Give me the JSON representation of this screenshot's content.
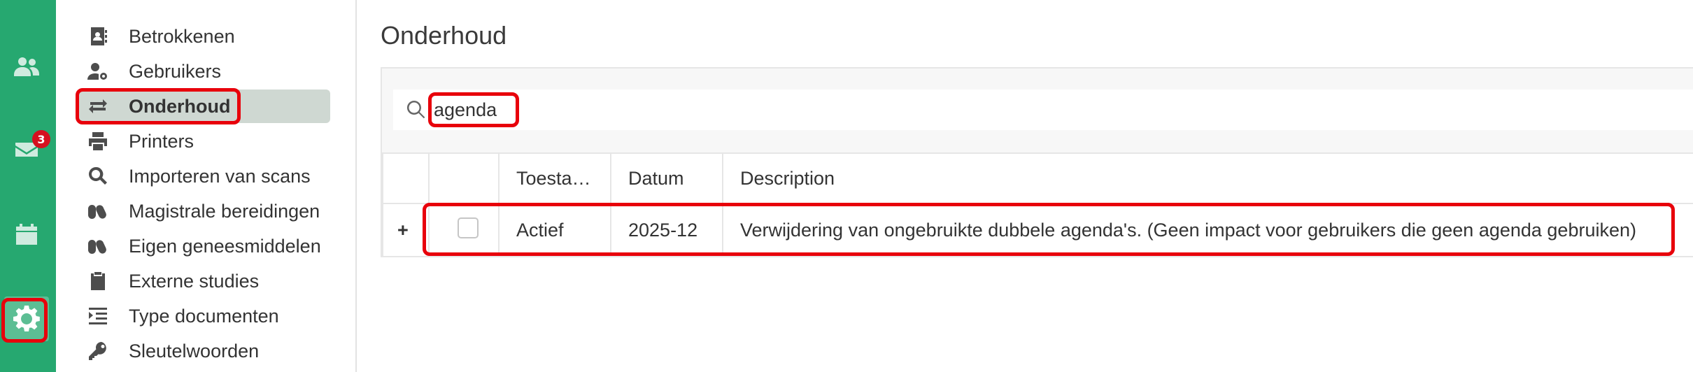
{
  "rail": {
    "items": [
      {
        "name": "users",
        "icon": "users-icon"
      },
      {
        "name": "messages",
        "icon": "envelope-icon",
        "badge": "3"
      },
      {
        "name": "calendar",
        "icon": "calendar-icon"
      },
      {
        "name": "settings",
        "icon": "gear-icon",
        "active": true
      }
    ]
  },
  "nav": {
    "items": [
      {
        "label": "Betrokkenen",
        "icon": "contact-book-icon"
      },
      {
        "label": "Gebruikers",
        "icon": "user-gear-icon"
      },
      {
        "label": "Onderhoud",
        "icon": "swap-arrows-icon",
        "active": true
      },
      {
        "label": "Printers",
        "icon": "printer-icon"
      },
      {
        "label": "Importeren van scans",
        "icon": "search-icon"
      },
      {
        "label": "Magistrale bereidingen",
        "icon": "capsules-icon"
      },
      {
        "label": "Eigen geneesmiddelen",
        "icon": "capsules-icon"
      },
      {
        "label": "Externe studies",
        "icon": "clipboard-icon"
      },
      {
        "label": "Type documenten",
        "icon": "indent-list-icon"
      },
      {
        "label": "Sleutelwoorden",
        "icon": "key-icon"
      }
    ]
  },
  "main": {
    "title": "Onderhoud",
    "search": {
      "value": "agenda",
      "placeholder": ""
    },
    "table": {
      "columns": [
        "",
        "",
        "Toesta…",
        "Datum",
        "Description"
      ],
      "rows": [
        {
          "expand": "+",
          "checked": false,
          "status": "Actief",
          "date": "2025-12",
          "description": "Verwijdering van ongebruikte dubbele agenda's. (Geen impact voor gebruikers die geen agenda gebruiken)"
        }
      ]
    }
  },
  "colors": {
    "rail": "#26a870",
    "badge": "#d6101f",
    "nav_active": "#cfd8d2",
    "annotation": "#e8000b"
  }
}
